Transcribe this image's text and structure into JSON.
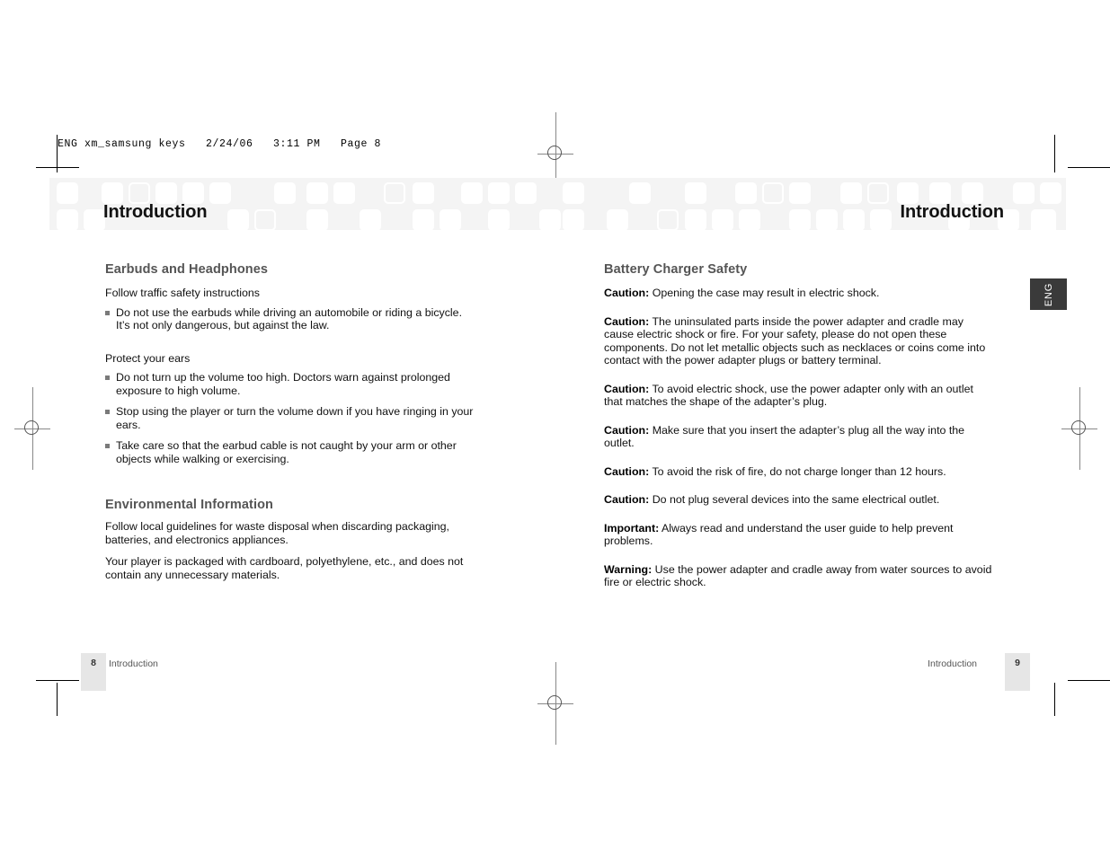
{
  "prepress": {
    "slug": "ENG xm_samsung keys   2/24/06   3:11 PM   Page 8"
  },
  "running_head": {
    "left_title": "Introduction",
    "right_title": "Introduction"
  },
  "side_tab": {
    "label": "ENG"
  },
  "left_page": {
    "sections": [
      {
        "heading": "Earbuds and Headphones",
        "lead": "Follow traffic safety instructions",
        "bullets": [
          "Do not use the earbuds while driving an automobile or riding a bicycle. It’s not only dangerous, but against the law."
        ],
        "lead2": "Protect your ears",
        "bullets2": [
          "Do not turn up the volume too high. Doctors warn against prolonged exposure to high volume.",
          "Stop using the player or turn the volume down if you have ringing in your ears.",
          "Take care so that the earbud cable is not caught by your arm or other objects while walking or exercising."
        ]
      },
      {
        "heading": "Environmental Information",
        "paragraphs": [
          "Follow local guidelines for waste disposal when discarding packaging, batteries, and electronics appliances.",
          "Your player is packaged with cardboard, polyethylene, etc., and does not contain any unnecessary materials."
        ]
      }
    ]
  },
  "right_page": {
    "heading": "Battery Charger Safety",
    "notices": [
      {
        "label": "Caution:",
        "text": " Opening the case may result in electric shock."
      },
      {
        "label": "Caution:",
        "text": " The uninsulated parts inside the power adapter and cradle may cause electric shock or fire. For your safety, please do not open these components. Do not let metallic objects such as necklaces or coins come into contact with the power adapter plugs or battery terminal."
      },
      {
        "label": "Caution:",
        "text": " To avoid electric shock, use the power adapter only with an outlet that matches the shape of the adapter’s plug."
      },
      {
        "label": "Caution:",
        "text": " Make sure that you insert the adapter’s plug all the way into the outlet."
      },
      {
        "label": "Caution:",
        "text": " To avoid the risk of fire, do not charge longer than 12 hours."
      },
      {
        "label": "Caution:",
        "text": " Do not plug several devices into the same electrical outlet."
      },
      {
        "label": "Important:",
        "text": " Always read and understand the user guide to help prevent problems."
      },
      {
        "label": "Warning:",
        "text": " Use the power adapter and cradle away from water sources to avoid fire or electric shock."
      }
    ]
  },
  "footer": {
    "left_page_number": "8",
    "left_label": "Introduction",
    "right_label": "Introduction",
    "right_page_number": "9"
  },
  "colors": {
    "band_background": "#f4f4f4",
    "heading_gray": "#555555",
    "bullet_gray": "#7a7a7a",
    "tab_dark": "#3a3a3a",
    "folio_box": "#e6e6e6"
  }
}
